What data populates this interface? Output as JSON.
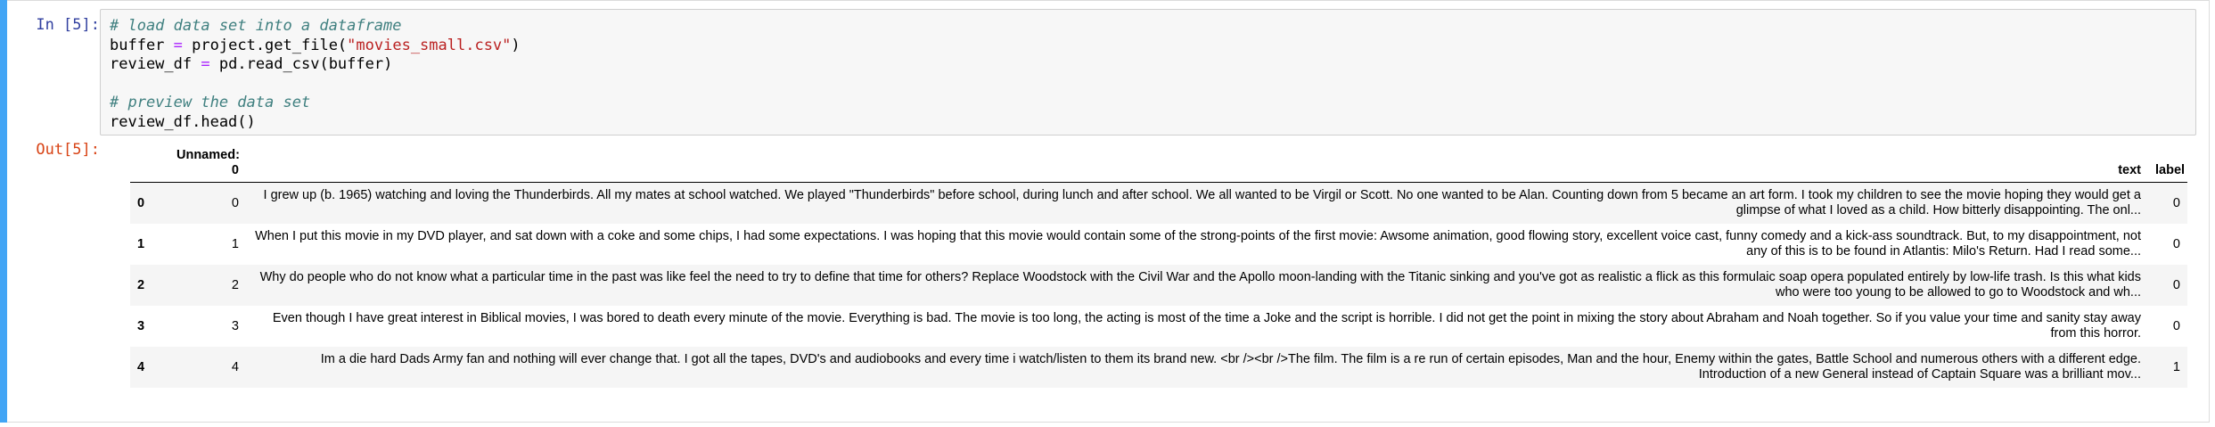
{
  "input": {
    "prompt": "In [5]:",
    "lines": [
      {
        "kind": "comment",
        "text": "# load data set into a dataframe"
      },
      {
        "kind": "assign",
        "var": "buffer",
        "op": "=",
        "expr": "project.get_file(",
        "str": "\"movies_small.csv\"",
        "tail": ")"
      },
      {
        "kind": "assign",
        "var": "review_df",
        "op": "=",
        "expr": "pd.read_csv(buffer)",
        "str": "",
        "tail": ""
      },
      {
        "kind": "blank",
        "text": ""
      },
      {
        "kind": "comment",
        "text": "# preview the data set"
      },
      {
        "kind": "plain",
        "text": "review_df.head()"
      }
    ]
  },
  "output": {
    "prompt": "Out[5]:",
    "columns": [
      "Unnamed: 0",
      "text",
      "label"
    ],
    "rows": [
      {
        "index": "0",
        "unnamed": "0",
        "text": "I grew up (b. 1965) watching and loving the Thunderbirds. All my mates at school watched. We played \"Thunderbirds\" before school, during lunch and after school. We all wanted to be Virgil or Scott. No one wanted to be Alan. Counting down from 5 became an art form. I took my children to see the movie hoping they would get a glimpse of what I loved as a child. How bitterly disappointing. The onl...",
        "label": "0"
      },
      {
        "index": "1",
        "unnamed": "1",
        "text": "When I put this movie in my DVD player, and sat down with a coke and some chips, I had some expectations. I was hoping that this movie would contain some of the strong-points of the first movie: Awsome animation, good flowing story, excellent voice cast, funny comedy and a kick-ass soundtrack. But, to my disappointment, not any of this is to be found in Atlantis: Milo's Return. Had I read some...",
        "label": "0"
      },
      {
        "index": "2",
        "unnamed": "2",
        "text": "Why do people who do not know what a particular time in the past was like feel the need to try to define that time for others? Replace Woodstock with the Civil War and the Apollo moon-landing with the Titanic sinking and you've got as realistic a flick as this formulaic soap opera populated entirely by low-life trash. Is this what kids who were too young to be allowed to go to Woodstock and wh...",
        "label": "0"
      },
      {
        "index": "3",
        "unnamed": "3",
        "text": "Even though I have great interest in Biblical movies, I was bored to death every minute of the movie. Everything is bad. The movie is too long, the acting is most of the time a Joke and the script is horrible. I did not get the point in mixing the story about Abraham and Noah together. So if you value your time and sanity stay away from this horror.",
        "label": "0"
      },
      {
        "index": "4",
        "unnamed": "4",
        "text": "Im a die hard Dads Army fan and nothing will ever change that. I got all the tapes, DVD's and audiobooks and every time i watch/listen to them its brand new. <br /><br />The film. The film is a re run of certain episodes, Man and the hour, Enemy within the gates, Battle School and numerous others with a different edge. Introduction of a new General instead of Captain Square was a brilliant mov...",
        "label": "1"
      }
    ]
  }
}
